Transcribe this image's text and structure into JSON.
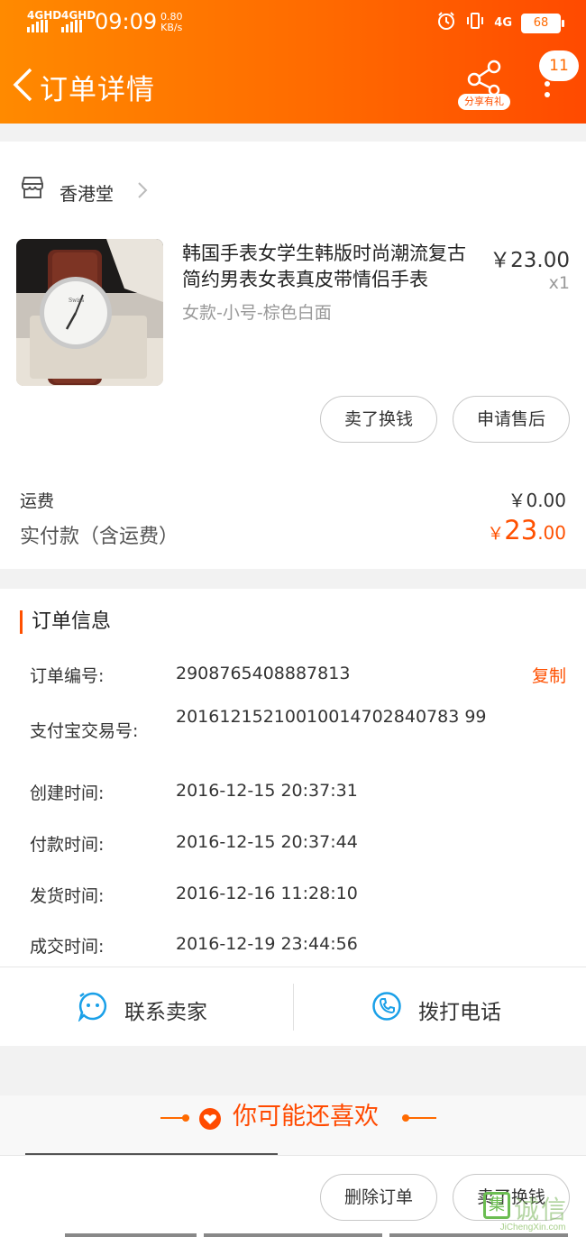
{
  "status_bar": {
    "signal_1": "4GHD",
    "signal_2": "4GHD",
    "time": "09:09",
    "speed_value": "0.80",
    "speed_unit": "KB/s",
    "network": "4G",
    "battery": "68"
  },
  "nav": {
    "title": "订单详情",
    "share_label": "分享有礼",
    "message_count": "11"
  },
  "shop": {
    "name": "香港堂"
  },
  "product": {
    "title": "韩国手表女学生韩版时尚潮流复古简约男表女表真皮带情侣手表",
    "sku": "女款-小号-棕色白面",
    "price": "￥23.00",
    "quantity": "x1",
    "action_sell": "卖了换钱",
    "action_aftersale": "申请售后"
  },
  "summary": {
    "shipping_label": "运费",
    "shipping_value": "￥0.00",
    "paid_label": "实付款（含运费）",
    "paid_currency": "￥",
    "paid_integer": "23",
    "paid_decimal": ".00"
  },
  "order_info": {
    "section_title": "订单信息",
    "copy_label": "复制",
    "rows": [
      {
        "label": "订单编号:",
        "value": "2908765408887813"
      },
      {
        "label": "支付宝交易号:",
        "value": "20161215210010014702840783 99"
      },
      {
        "label": "创建时间:",
        "value": "2016-12-15 20:37:31"
      },
      {
        "label": "付款时间:",
        "value": "2016-12-15 20:37:44"
      },
      {
        "label": "发货时间:",
        "value": "2016-12-16 11:28:10"
      },
      {
        "label": "成交时间:",
        "value": "2016-12-19 23:44:56"
      }
    ]
  },
  "contact": {
    "seller_label": "联系卖家",
    "phone_label": "拨打电话"
  },
  "recommend": {
    "title": "你可能还喜欢"
  },
  "bottom_actions": {
    "delete_label": "删除订单",
    "sell_label": "卖了换钱"
  },
  "watermark": {
    "badge": "集",
    "big_text": "诚信",
    "small_text": "JiChengXin.com"
  },
  "colors": {
    "accent": "#ff5000",
    "header_start": "#ff8a00",
    "header_end": "#ff4a00",
    "contact_icon": "#1aa0e8"
  }
}
